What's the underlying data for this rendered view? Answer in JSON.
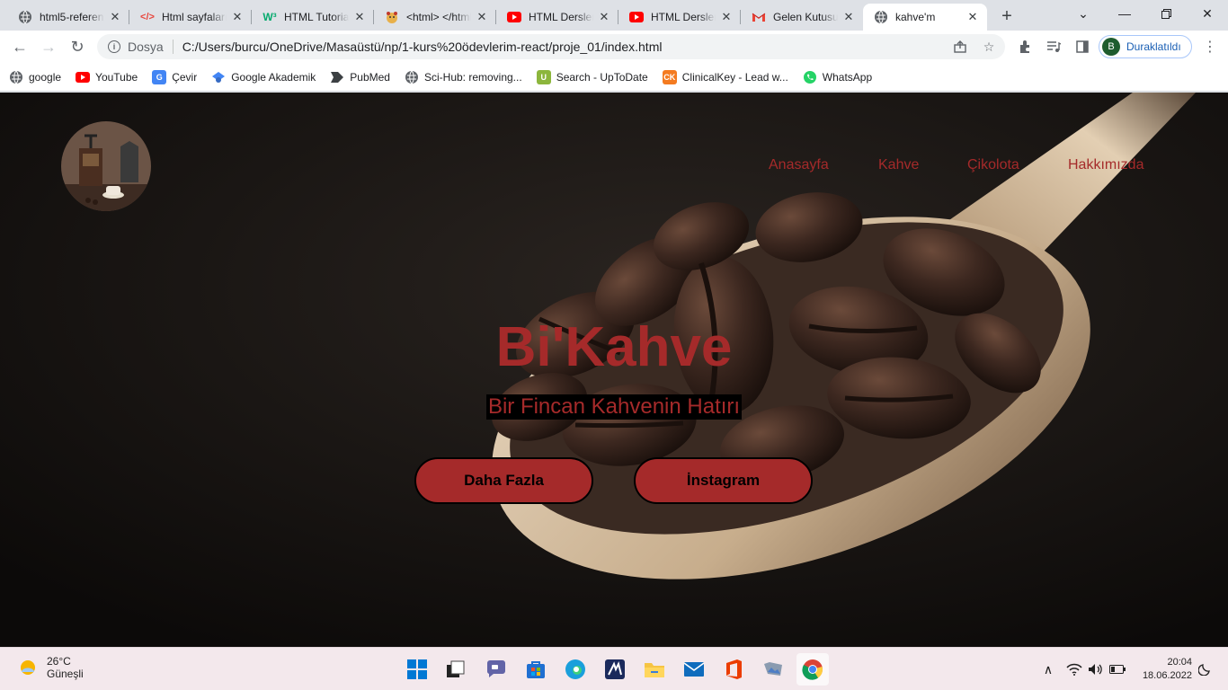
{
  "browser": {
    "tabs": [
      {
        "title": "html5-referen",
        "favicon": "globe-icon"
      },
      {
        "title": "Html sayfaları",
        "favicon": "code-icon"
      },
      {
        "title": "HTML Tutorial",
        "favicon": "w3-icon"
      },
      {
        "title": "<html> </html>",
        "favicon": "bear-icon"
      },
      {
        "title": "HTML Dersleri",
        "favicon": "youtube-icon"
      },
      {
        "title": "HTML Dersleri",
        "favicon": "youtube-icon"
      },
      {
        "title": "Gelen Kutusu",
        "favicon": "gmail-icon"
      },
      {
        "title": "kahve'm",
        "favicon": "globe-icon",
        "active": true
      }
    ],
    "address": {
      "scheme_label": "Dosya",
      "url": "C:/Users/burcu/OneDrive/Masaüstü/np/1-kurs%20ödevlerim-react/proje_01/index.html"
    },
    "profile": {
      "initial": "B",
      "status": "Duraklatıldı"
    },
    "bookmarks": [
      {
        "label": "google",
        "icon": "globe-icon"
      },
      {
        "label": "YouTube",
        "icon": "youtube-icon"
      },
      {
        "label": "Çevir",
        "icon": "translate-icon"
      },
      {
        "label": "Google Akademik",
        "icon": "scholar-icon"
      },
      {
        "label": "PubMed",
        "icon": "pubmed-icon"
      },
      {
        "label": "Sci-Hub: removing...",
        "icon": "globe-icon"
      },
      {
        "label": "Search - UpToDate",
        "icon": "uptodate-icon"
      },
      {
        "label": "ClinicalKey - Lead w...",
        "icon": "clinicalkey-icon"
      },
      {
        "label": "WhatsApp",
        "icon": "whatsapp-icon"
      }
    ]
  },
  "site": {
    "nav": [
      "Anasayfa",
      "Kahve",
      "Çikolota",
      "Hakkımızda"
    ],
    "title": "Bi'Kahve",
    "subtitle": "Bir Fincan Kahvenin Hatırı",
    "buttons": {
      "more": "Daha Fazla",
      "instagram": "İnstagram"
    },
    "accent_color": "#a52a2a"
  },
  "taskbar": {
    "weather": {
      "temp": "26°C",
      "condition": "Güneşli"
    },
    "time": "20:04",
    "date": "18.06.2022"
  }
}
